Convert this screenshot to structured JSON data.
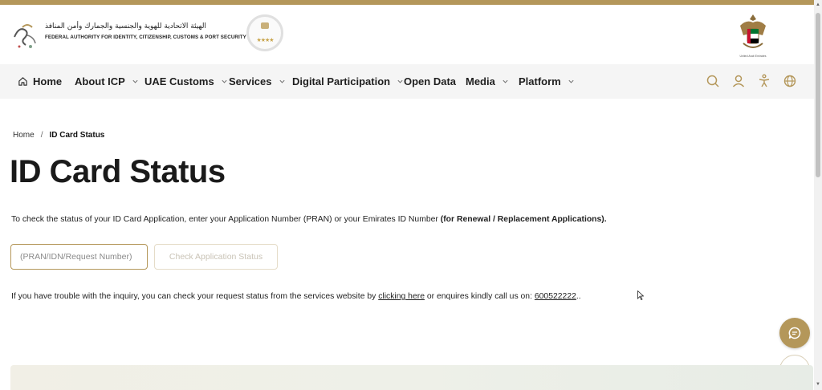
{
  "header": {
    "logo_arabic": "الهيئة الاتحادية للهوية والجنسية والجمارك وأمن المنافذ",
    "logo_english": "FEDERAL AUTHORITY FOR IDENTITY, CITIZENSHIP, CUSTOMS & PORT SECURITY",
    "stars_rating": "★★★★",
    "emblem_caption": "United Arab Emirates"
  },
  "nav": {
    "items": [
      {
        "label": "Home",
        "icon": "home-icon",
        "has_dropdown": false
      },
      {
        "label": "About ICP",
        "has_dropdown": true
      },
      {
        "label": "UAE Customs",
        "has_dropdown": true
      },
      {
        "label": "Services",
        "has_dropdown": true
      },
      {
        "label": "Digital Participation",
        "has_dropdown": true
      },
      {
        "label": "Open Data",
        "has_dropdown": false
      },
      {
        "label": "Media",
        "has_dropdown": true
      },
      {
        "label": "Platform",
        "has_dropdown": true
      }
    ],
    "tools": [
      "search-icon",
      "user-icon",
      "accessibility-icon",
      "globe-icon"
    ]
  },
  "breadcrumb": {
    "home": "Home",
    "separator": "/",
    "current": "ID Card Status"
  },
  "page": {
    "title": "ID Card Status",
    "intro_text": "To check the status of your ID Card Application, enter your Application Number (PRAN) or your Emirates ID Number ",
    "intro_bold": "(for Renewal / Replacement Applications).",
    "input_placeholder": "(PRAN/IDN/Request Number)",
    "input_value": "",
    "check_button": "Check Application Status",
    "help_prefix": "If you have trouble with the inquiry, you can check your request status from the services website by ",
    "help_link": "clicking here",
    "help_middle": " or enquires kindly call us on: ",
    "help_phone": "600522222",
    "help_suffix": ".."
  },
  "colors": {
    "accent": "#b4975a",
    "nav_bg": "#f5f5f5",
    "text": "#1f1f1f"
  }
}
